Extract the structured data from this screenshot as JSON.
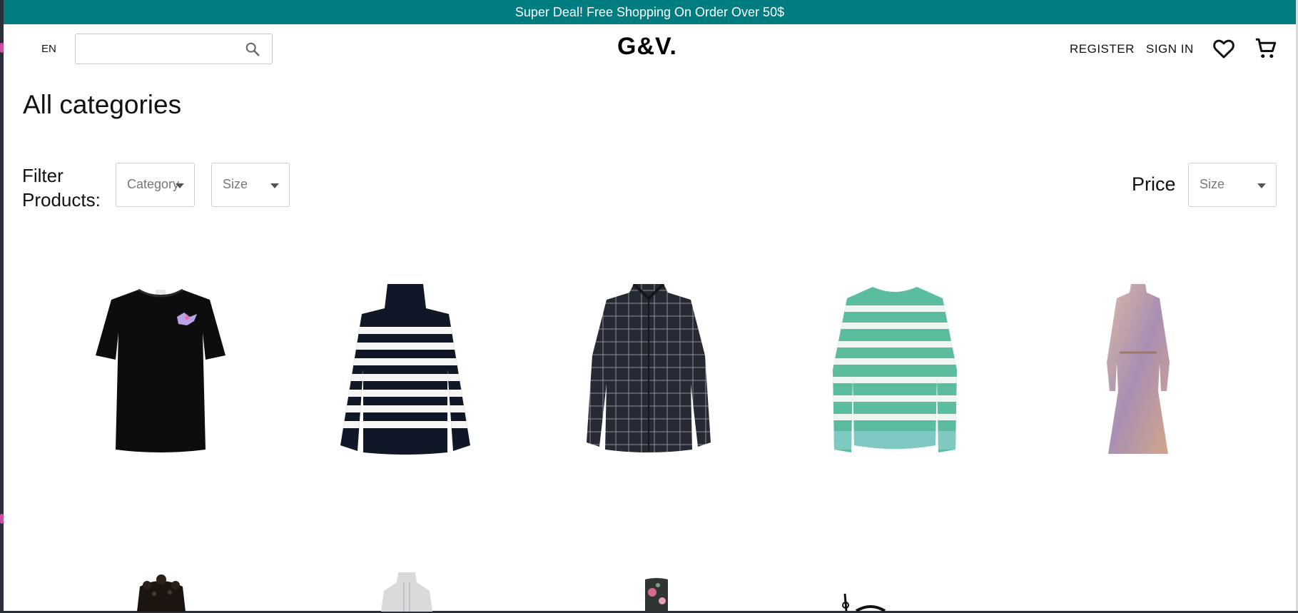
{
  "promo": {
    "text": "Super Deal! Free Shopping On Order Over 50$"
  },
  "header": {
    "language": "EN",
    "search": {
      "placeholder": "",
      "value": ""
    },
    "logo": "G&V.",
    "register_label": "REGISTER",
    "sign_in_label": "SIGN IN",
    "icons": [
      "search-icon",
      "heart-icon",
      "cart-icon"
    ]
  },
  "page": {
    "title": "All categories"
  },
  "filters": {
    "label": "Filter Products:",
    "category": {
      "selected": "Category"
    },
    "size": {
      "selected": "Size"
    },
    "price_label": "Price",
    "price": {
      "selected": "Size"
    }
  },
  "products": [
    {
      "kind": "black t-shirt",
      "color": "#0d0d0d"
    },
    {
      "kind": "navy white striped sweater",
      "color": "#101828"
    },
    {
      "kind": "dark checked shirt",
      "color": "#262a33"
    },
    {
      "kind": "green striped knit sweater",
      "color": "#5bbca0"
    },
    {
      "kind": "floral midi dress",
      "color": "#c7a38f"
    },
    {
      "kind": "black lace top",
      "color": "#1b1410"
    },
    {
      "kind": "light grey knit",
      "color": "#d9dadc"
    },
    {
      "kind": "floral boot",
      "color": "#2f3532"
    },
    {
      "kind": "black accessory",
      "color": "#111111"
    }
  ],
  "theme": {
    "accent": "#017c80"
  }
}
